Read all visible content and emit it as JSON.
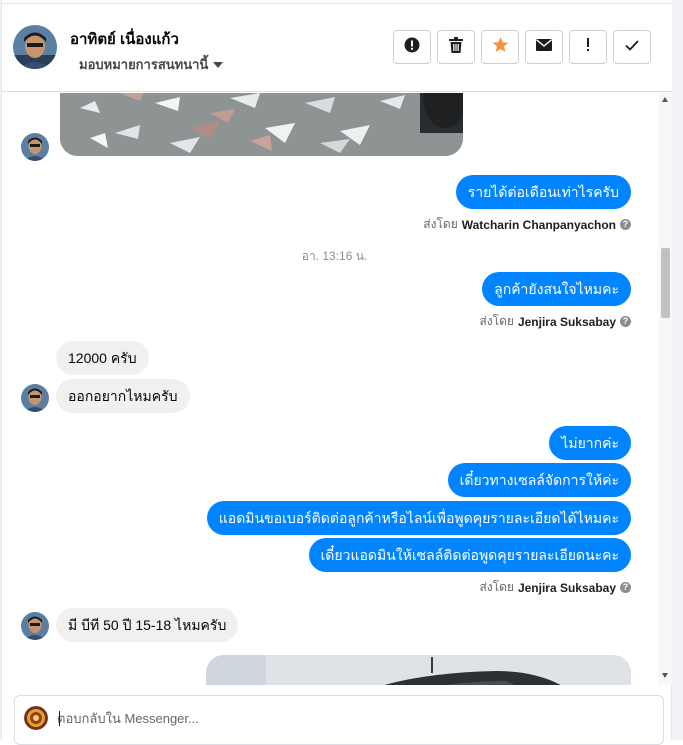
{
  "header": {
    "name": "อาทิตย์ เนื่องแก้ว",
    "assign_label": "มอบหมายการสนทนานี้",
    "actions": [
      {
        "name": "spam-icon"
      },
      {
        "name": "trash-icon"
      },
      {
        "name": "star-icon"
      },
      {
        "name": "envelope-icon"
      },
      {
        "name": "exclamation-icon"
      },
      {
        "name": "checkmark-icon"
      }
    ]
  },
  "messages": {
    "m1": "รายได้ต่อเดือนเท่าไรครับ",
    "sent1_prefix": "ส่งโดย",
    "sent1_name": "Watcharin Chanpanyachon",
    "timestamp": "อา. 13:16 น.",
    "m2": "ลูกค้ายังสนใจไหมคะ",
    "sent2_prefix": "ส่งโดย",
    "sent2_name": "Jenjira Suksabay",
    "m3": "12000 ครับ",
    "m4": "ออกอยากไหมครับ",
    "m5": "ไม่ยากค่ะ",
    "m6": "เดี๋ยวทางเซลล์จัดการให้ค่ะ",
    "m7": "แอดมินขอเบอร์ติดต่อลูกค้าหรือไลน์เพื่อพูดคุยรายละเอียดได้ไหมคะ",
    "m8": "เดี๋ยวแอดมินให้เซลล์ติดต่อพูดคุยรายละเอียดนะคะ",
    "sent3_prefix": "ส่งโดย",
    "sent3_name": "Jenjira Suksabay",
    "m9": "มี บีที 50 ปี 15-18 ไหมครับ",
    "help_glyph": "?"
  },
  "composer": {
    "placeholder": "ตอบกลับใน Messenger..."
  },
  "colors": {
    "outgoing_bubble": "#0084ff",
    "incoming_bubble": "#f0f0f0",
    "star": "#f7923b"
  }
}
